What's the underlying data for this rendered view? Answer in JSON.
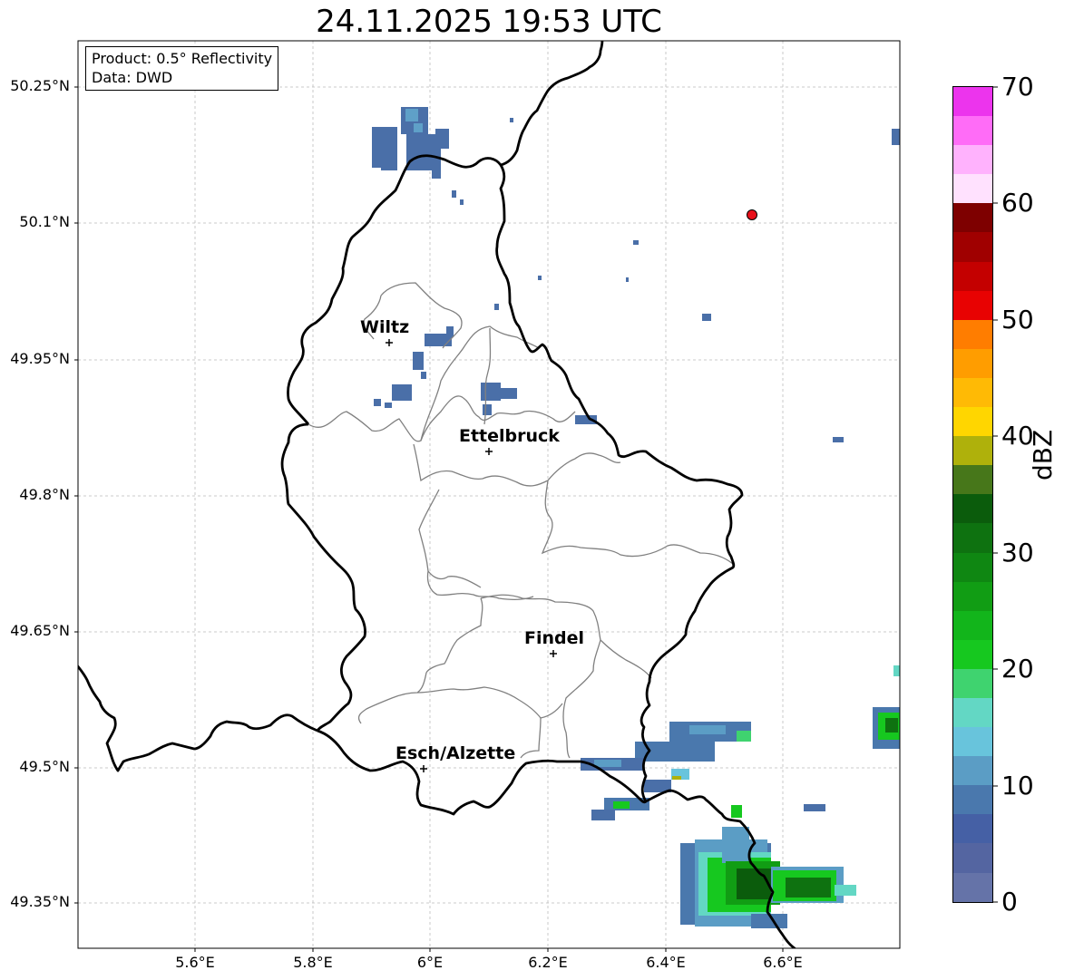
{
  "title": "24.11.2025 19:53 UTC",
  "info": {
    "product": "Product: 0.5° Reflectivity",
    "data_source": "Data: DWD"
  },
  "axes": {
    "y_ticks": [
      "50.25°N",
      "50.1°N",
      "49.95°N",
      "49.8°N",
      "49.65°N",
      "49.5°N",
      "49.35°N"
    ],
    "x_ticks": [
      "5.6°E",
      "5.8°E",
      "6°E",
      "6.2°E",
      "6.4°E",
      "6.6°E"
    ]
  },
  "cities": [
    {
      "name": "Wiltz",
      "lon": 5.93,
      "lat": 49.97
    },
    {
      "name": "Ettelbruck",
      "lon": 6.1,
      "lat": 49.85
    },
    {
      "name": "Findel",
      "lon": 6.21,
      "lat": 49.63
    },
    {
      "name": "Esch/Alzette",
      "lon": 5.99,
      "lat": 49.5
    }
  ],
  "marker": {
    "lon": 6.55,
    "lat": 50.11,
    "color": "#e8101a"
  },
  "colorbar": {
    "label": "dBZ",
    "ticks": [
      "0",
      "10",
      "20",
      "30",
      "40",
      "50",
      "60",
      "70"
    ],
    "min": 0,
    "max": 70,
    "step": 2.5,
    "colors": [
      "#6573a8",
      "#5465a1",
      "#4560a5",
      "#4a78ad",
      "#5b9dc5",
      "#68c4dc",
      "#63d7c4",
      "#3fd36f",
      "#16c81f",
      "#12b51b",
      "#119d14",
      "#0f8712",
      "#0e7210",
      "#0b5c0c",
      "#47771a",
      "#afb10b",
      "#ffd600",
      "#ffba05",
      "#ff9d00",
      "#ff7d00",
      "#e80202",
      "#c40000",
      "#a00000",
      "#7e0000",
      "#ffe1fe",
      "#ffb2fd",
      "#ff6cf7",
      "#ec34ed"
    ]
  }
}
